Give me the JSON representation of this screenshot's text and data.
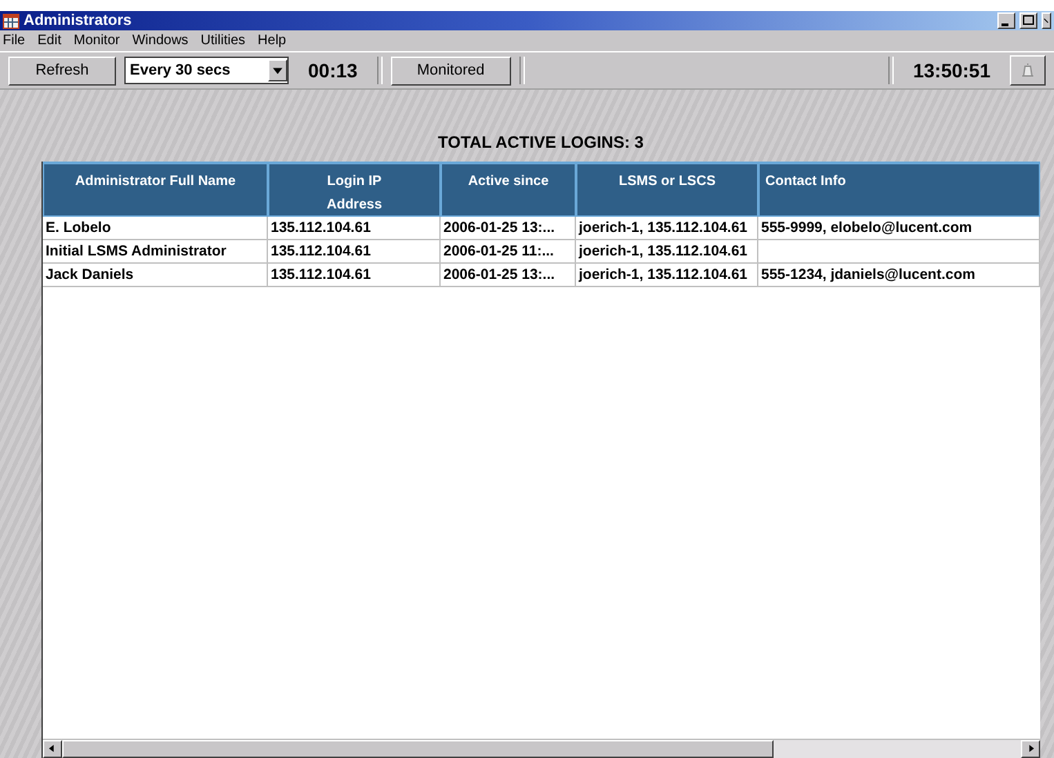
{
  "window": {
    "title": "Administrators"
  },
  "menu": [
    "File",
    "Edit",
    "Monitor",
    "Windows",
    "Utilities",
    "Help"
  ],
  "toolbar": {
    "refresh": "Refresh",
    "interval": "Every 30 secs",
    "countdown": "00:13",
    "monitored": "Monitored",
    "clock": "13:50:51"
  },
  "heading": "TOTAL ACTIVE LOGINS: 3",
  "table": {
    "columns": [
      "Administrator Full Name",
      "Login IP Address",
      "Active since",
      "LSMS or LSCS",
      "Contact Info"
    ],
    "rows": [
      [
        "E. Lobelo",
        "135.112.104.61",
        "2006-01-25 13:...",
        "joerich-1, 135.112.104.61",
        "555-9999, elobelo@lucent.com"
      ],
      [
        "Initial LSMS Administrator",
        "135.112.104.61",
        "2006-01-25 11:...",
        "joerich-1, 135.112.104.61",
        ""
      ],
      [
        "Jack Daniels",
        "135.112.104.61",
        "2006-01-25 13:...",
        "joerich-1, 135.112.104.61",
        "555-1234, jdaniels@lucent.com"
      ]
    ]
  }
}
